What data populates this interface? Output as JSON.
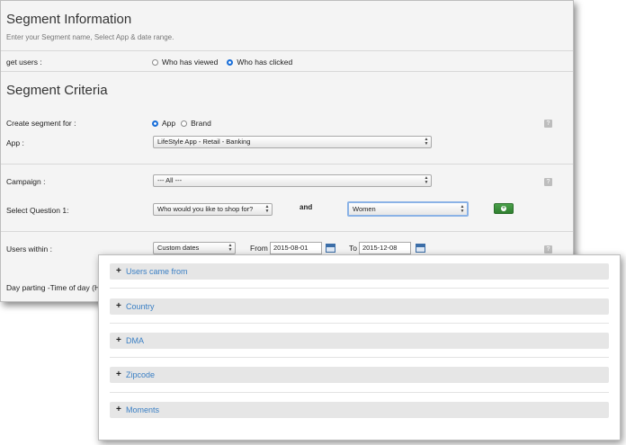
{
  "segment_info": {
    "title": "Segment Information",
    "subtitle": "Enter your Segment name, Select App & date range.",
    "get_users_label": "get users :",
    "get_users_options": [
      {
        "label": "Who has viewed",
        "selected": false
      },
      {
        "label": "Who has clicked",
        "selected": true
      }
    ]
  },
  "criteria": {
    "title": "Segment Criteria",
    "create_for_label": "Create segment for :",
    "create_for_options": [
      {
        "label": "App",
        "selected": true
      },
      {
        "label": "Brand",
        "selected": false
      }
    ],
    "app_label": "App :",
    "app_value": "LifeStyle App - Retail - Banking",
    "campaign_label": "Campaign :",
    "campaign_value": "--- All ---",
    "question_label": "Select Question 1:",
    "question_value": "Who would you like to shop for?",
    "and_label": "and",
    "answer_value": "Women",
    "users_within_label": "Users within :",
    "users_within_value": "Custom dates",
    "from_label": "From",
    "from_value": "2015-08-01",
    "to_label": "To",
    "to_value": "2015-12-08",
    "day_parting_label": "Day parting -Time of day (H",
    "help_glyph": "?",
    "add_glyph": "+"
  },
  "filters": {
    "expand_glyph": "+",
    "sections": [
      {
        "label": "Users came from"
      },
      {
        "label": "Country"
      },
      {
        "label": "DMA"
      },
      {
        "label": "Zipcode"
      },
      {
        "label": "Moments"
      }
    ]
  },
  "colors": {
    "accent_blue": "#1a6fd9",
    "link_blue": "#3a7fc4",
    "add_green": "#3a8f3a"
  }
}
